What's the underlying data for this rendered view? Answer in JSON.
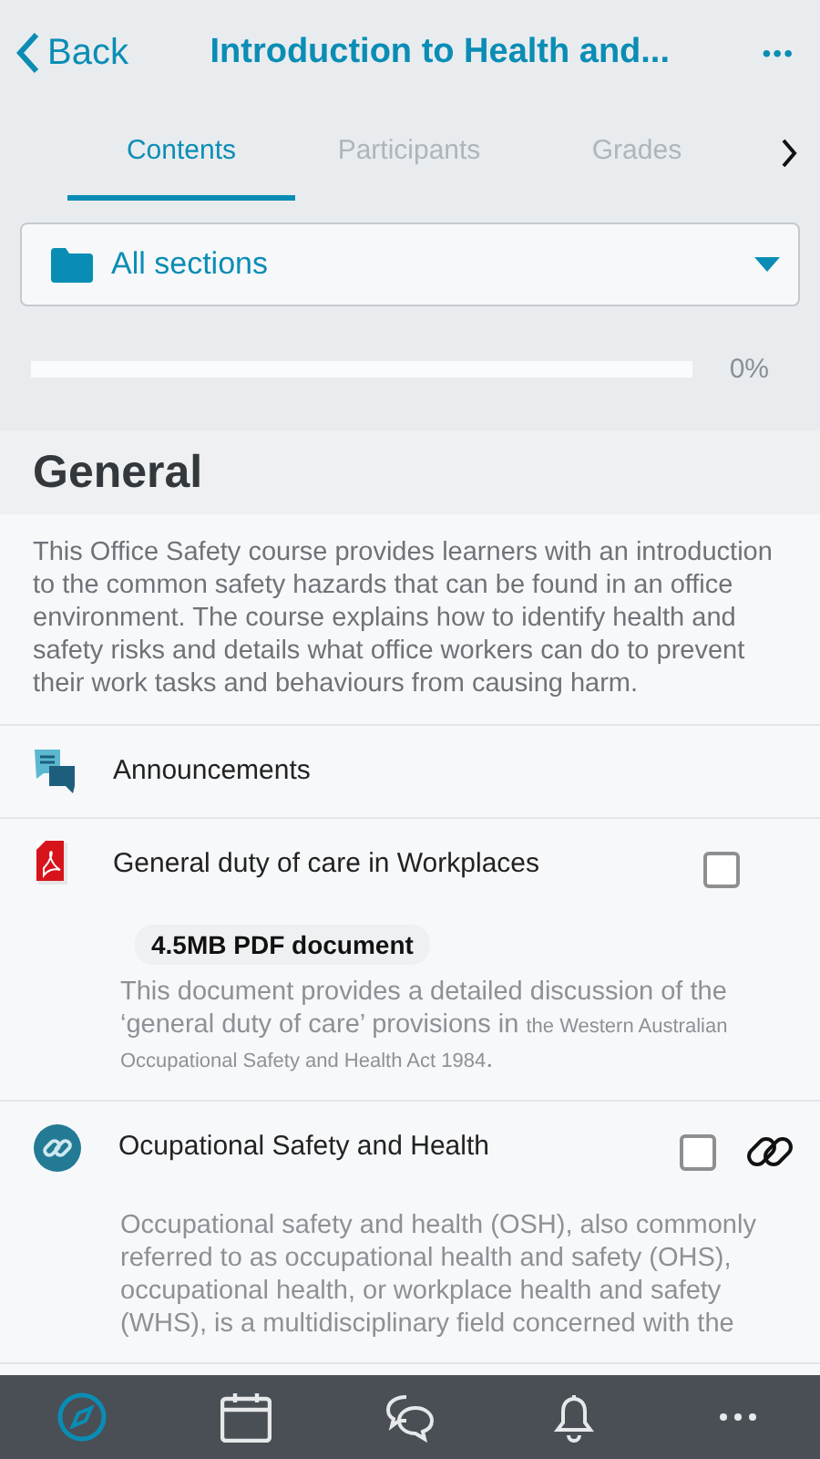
{
  "header": {
    "back": "Back",
    "title": "Introduction to Health and...",
    "more": "•••"
  },
  "tabs": [
    {
      "label": "Contents",
      "selected": true
    },
    {
      "label": "Participants",
      "selected": false
    },
    {
      "label": "Grades",
      "selected": false
    }
  ],
  "section_select": {
    "value": "All sections"
  },
  "progress": {
    "level": 0,
    "reading": "0%"
  },
  "section": {
    "title": "General",
    "summary": "This Office Safety course provides learners with an introduction to the common safety hazards that can be found in an office environment. The course explains how to identify health and safety risks and details what office workers can do to prevent their work tasks and behaviours from causing harm."
  },
  "modules": [
    {
      "kind": "forum",
      "name": "Announcements"
    },
    {
      "kind": "pdf",
      "name": "General duty of care in Workplaces",
      "checked": false,
      "badge": "4.5MB PDF document",
      "description": [
        {
          "kind": "normal",
          "text": "This document provides a detailed discussion of the ‘general duty of care’ provisions in "
        },
        {
          "kind": "small",
          "text": "the Western Australian Occupational Safety and Health Act 1984"
        },
        {
          "kind": "normal",
          "text": "."
        }
      ]
    },
    {
      "kind": "url",
      "name": "Ocupational Safety and Health",
      "checked": false,
      "description": [
        {
          "kind": "normal",
          "text": "Occupational safety and health (OSH), also commonly referred to as occupational health and safety (OHS), occupational health, or workplace health and safety (WHS), is a multidisciplinary field concerned with the"
        }
      ]
    }
  ],
  "bottom_nav": [
    {
      "kind": "compass",
      "selected": true
    },
    {
      "kind": "calendar",
      "selected": false
    },
    {
      "kind": "chat",
      "selected": false
    },
    {
      "kind": "bell",
      "selected": false
    },
    {
      "kind": "more",
      "selected": false
    }
  ]
}
